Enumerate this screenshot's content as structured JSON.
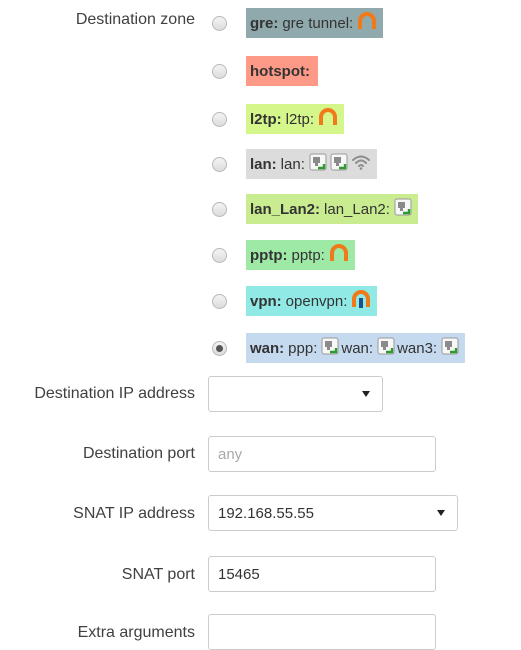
{
  "destination_zone": {
    "label": "Destination zone",
    "zones": [
      {
        "name": "gre:",
        "devices": [
          {
            "text": "gre tunnel:",
            "icon": "tunnel-icon"
          }
        ],
        "color": "#90a9ac",
        "selected": false
      },
      {
        "name": "hotspot:",
        "devices": [],
        "color": "#fd9a87",
        "selected": false
      },
      {
        "name": "l2tp:",
        "devices": [
          {
            "text": "l2tp:",
            "icon": "tunnel-icon"
          }
        ],
        "color": "#d5f68a",
        "selected": false
      },
      {
        "name": "lan:",
        "devices": [
          {
            "text": "lan:",
            "icon": "ethernet-icon"
          },
          {
            "text": "",
            "icon": "ethernet-icon"
          },
          {
            "text": "",
            "icon": "wifi-icon"
          }
        ],
        "color": "#dcdcdc",
        "selected": false
      },
      {
        "name": "lan_Lan2:",
        "devices": [
          {
            "text": "lan_Lan2:",
            "icon": "ethernet-icon"
          }
        ],
        "color": "#c8ec8f",
        "selected": false
      },
      {
        "name": "pptp:",
        "devices": [
          {
            "text": "pptp:",
            "icon": "tunnel-icon"
          }
        ],
        "color": "#9ee9a6",
        "selected": false
      },
      {
        "name": "vpn:",
        "devices": [
          {
            "text": "openvpn:",
            "icon": "vpn-tunnel-icon"
          }
        ],
        "color": "#91e9e6",
        "selected": false
      },
      {
        "name": "wan:",
        "devices": [
          {
            "text": "ppp:",
            "icon": "ethernet-icon"
          },
          {
            "text": "wan:",
            "icon": "ethernet-icon"
          },
          {
            "text": "wan3:",
            "icon": "ethernet-icon"
          }
        ],
        "color": "#c5d9ef",
        "selected": true
      }
    ]
  },
  "destination_ip": {
    "label": "Destination IP address",
    "value": ""
  },
  "destination_port": {
    "label": "Destination port",
    "placeholder": "any",
    "value": ""
  },
  "snat_ip": {
    "label": "SNAT IP address",
    "value": "192.168.55.55"
  },
  "snat_port": {
    "label": "SNAT port",
    "value": "15465"
  },
  "extra_arguments": {
    "label": "Extra arguments",
    "value": ""
  }
}
